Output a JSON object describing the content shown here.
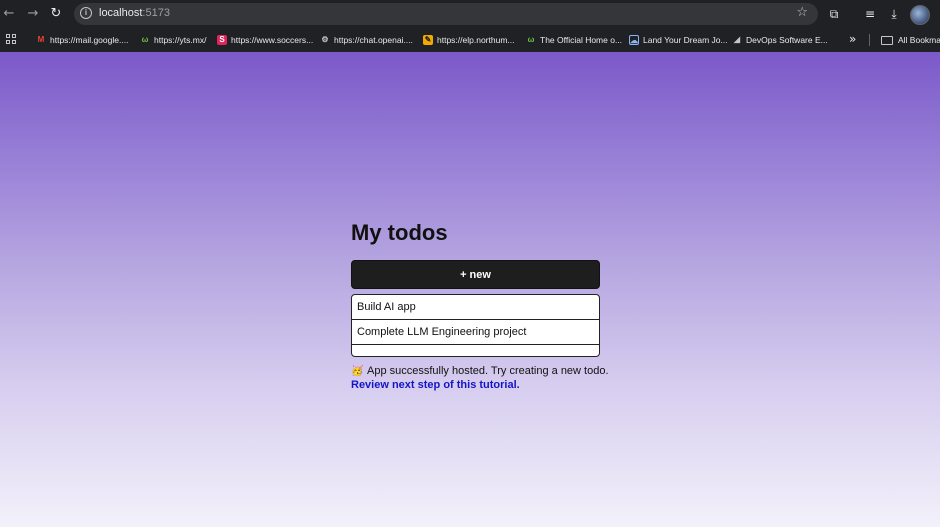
{
  "browser": {
    "url_host": "localhost",
    "url_port": ":5173",
    "bookmarks": [
      {
        "label": "https://mail.google....",
        "icon": "gmail-icon",
        "color": "#ea4335"
      },
      {
        "label": "https://yts.mx/",
        "icon": "yts-icon",
        "color": "#6ac045"
      },
      {
        "label": "https://www.soccers...",
        "icon": "soccer-site-icon",
        "color": "#e0245e"
      },
      {
        "label": "https://chat.openai....",
        "icon": "openai-icon",
        "color": "#c4c7c5"
      },
      {
        "label": "https://elp.northum...",
        "icon": "elp-icon",
        "color": "#f2a900"
      },
      {
        "label": "The Official Home o...",
        "icon": "official-home-icon",
        "color": "#6ac045"
      },
      {
        "label": "Land Your Dream Jo...",
        "icon": "job-cloud-icon",
        "color": "#8ab4f8"
      },
      {
        "label": "DevOps Software E...",
        "icon": "devops-icon",
        "color": "#c4c7c5"
      }
    ],
    "all_bookmarks_label": "All Bookmar"
  },
  "app": {
    "title": "My todos",
    "new_button_label": "+ new",
    "todos": [
      {
        "content": "Build AI app"
      },
      {
        "content": "Complete LLM Engineering project"
      }
    ],
    "status_emoji": "🥳",
    "status_text": "App successfully hosted. Try creating a new todo.",
    "tutorial_link_text": "Review next step of this tutorial."
  }
}
